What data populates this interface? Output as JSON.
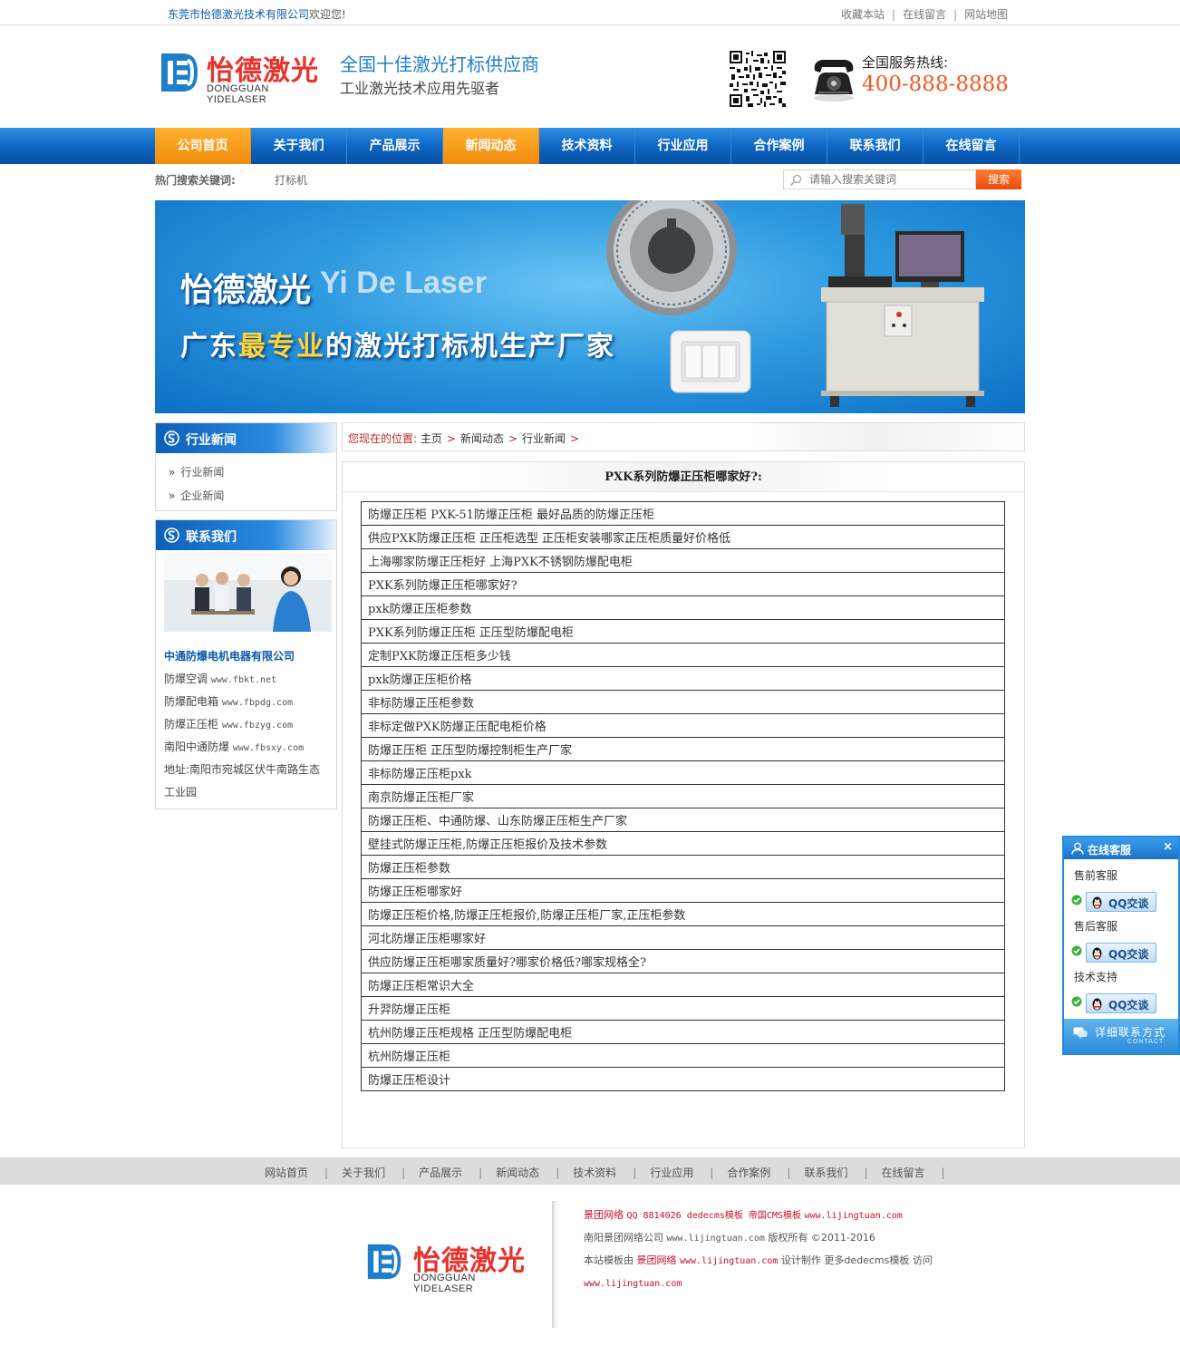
{
  "topbar": {
    "company": "东莞市怡德激光技术有限公司",
    "welcome": "欢迎您!",
    "links": [
      "收藏本站",
      "在线留言",
      "网站地图"
    ],
    "separator": "|"
  },
  "header": {
    "logo_cn": "怡德激光",
    "logo_en": "DONGGUAN YIDELASER",
    "slogan1": "全国十佳激光打标供应商",
    "slogan2": "工业激光技术应用先驱者",
    "hotline_label": "全国服务热线:",
    "hotline": "400-888-8888"
  },
  "nav": {
    "items": [
      "公司首页",
      "关于我们",
      "产品展示",
      "新闻动态",
      "技术资料",
      "行业应用",
      "合作案例",
      "联系我们",
      "在线留言"
    ],
    "active_indexes": [
      0,
      3
    ]
  },
  "search": {
    "hot_label": "热门搜索关键词:",
    "hot_word": "打标机",
    "placeholder": "请输入搜索关键词",
    "button": "搜索"
  },
  "banner": {
    "title_cn": "怡德激光",
    "title_en": "Yi De Laser",
    "sub_before": "广东",
    "sub_highlight": "最专业",
    "sub_after": "的激光打标机生产厂家"
  },
  "sidebar": {
    "news_title": "行业新闻",
    "news_items": [
      "行业新闻",
      "企业新闻"
    ],
    "contact_title": "联系我们",
    "company": "中通防爆电机电器有限公司",
    "contact_lines": [
      {
        "label": "防爆空调",
        "url": "www.fbkt.net"
      },
      {
        "label": "防爆配电箱",
        "url": "www.fbpdg.com"
      },
      {
        "label": "防爆正压柜",
        "url": "www.fbzyg.com"
      },
      {
        "label": "南阳中通防爆",
        "url": "www.fbsxy.com"
      }
    ],
    "address_1": "地址:南阳市宛城区伏牛南路生态",
    "address_2": "工业园"
  },
  "breadcrumb": {
    "label": "您现在的位置:",
    "items": [
      "主页",
      "新闻动态",
      "行业新闻"
    ],
    "arrow": ">"
  },
  "article": {
    "title": "PXK系列防爆正压柜哪家好?:",
    "rows": [
      "防爆正压柜 PXK-51防爆正压柜 最好品质的防爆正压柜",
      "供应PXK防爆正压柜 正压柜选型 正压柜安装哪家正压柜质量好价格低",
      "上海哪家防爆正压柜好 上海PXK不锈钢防爆配电柜",
      "PXK系列防爆正压柜哪家好?",
      "pxk防爆正压柜参数",
      "PXK系列防爆正压柜 正压型防爆配电柜",
      "定制PXK防爆正压柜多少钱",
      "pxk防爆正压柜价格",
      "非标防爆正压柜参数",
      "非标定做PXK防爆正压配电柜价格",
      "防爆正压柜 正压型防爆控制柜生产厂家",
      "非标防爆正压柜pxk",
      "南京防爆正压柜厂家",
      "防爆正压柜、中通防爆、山东防爆正压柜生产厂家",
      "壁挂式防爆正压柜,防爆正压柜报价及技术参数",
      "防爆正压柜参数",
      "防爆正压柜哪家好",
      "防爆正压柜价格,防爆正压柜报价,防爆正压柜厂家,正压柜参数",
      "河北防爆正压柜哪家好",
      "供应防爆正压柜哪家质量好?哪家价格低?哪家规格全?",
      "防爆正压柜常识大全",
      "升羿防爆正压柜",
      "杭州防爆正压柜规格 正压型防爆配电柜",
      "杭州防爆正压柜",
      "防爆正压柜设计"
    ]
  },
  "footer": {
    "nav": [
      "网站首页",
      "关于我们",
      "产品展示",
      "新闻动态",
      "技术资料",
      "行业应用",
      "合作案例",
      "联系我们",
      "在线留言"
    ],
    "separator": "|",
    "logo_cn": "怡德激光",
    "logo_en": "DONGGUAN YIDELASER",
    "line1_a": "景团网络",
    "line1_b": "QQ 8814026 dedecms模板 帝国CMS模板",
    "line1_c": "www.lijingtuan.com",
    "line2_a": "南阳景团网络公司",
    "line2_b": "www.lijingtuan.com",
    "line2_c": "版权所有 ©2011-2016",
    "line3_a": "本站模板由",
    "line3_b": "景团网络",
    "line3_c": "www.lijingtuan.com",
    "line3_d": "设计制作 更多dedecms模板 访问",
    "line4": "www.lijingtuan.com"
  },
  "service": {
    "title": "在线客服",
    "close": "×",
    "groups": [
      {
        "label": "售前客服",
        "button": "QQ交谈"
      },
      {
        "label": "售后客服",
        "button": "QQ交谈"
      },
      {
        "label": "技术支持",
        "button": "QQ交谈"
      }
    ],
    "footer_cn": "详细联系方式",
    "footer_en": "CONTACT"
  },
  "colors": {
    "nav_blue": "#0d63c0",
    "nav_active": "#f08c10",
    "hotline": "#f15a22",
    "logo_red": "#e8322b",
    "logo_blue": "#1d7fc9",
    "crumb_red": "#c0272d"
  }
}
